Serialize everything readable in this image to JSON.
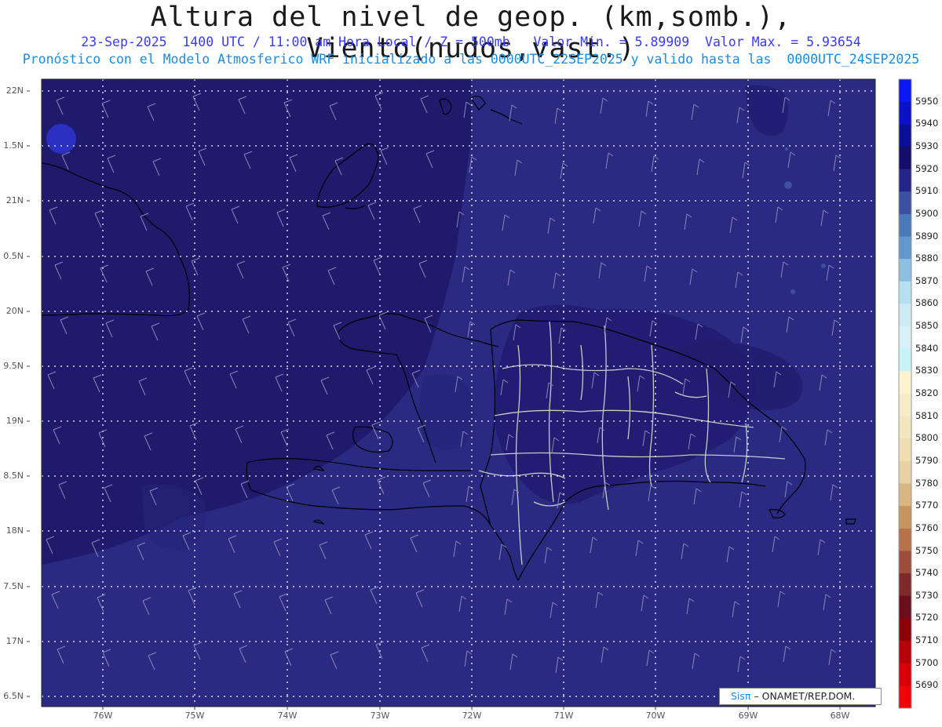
{
  "header": {
    "title": "Altura del nivel de geop. (km,somb.), Viento(nudos,vast.)",
    "subtitle": "23-Sep-2025  1400 UTC / 11:00 am Hora Local / Z = 500mb   Valor Min. = 5.89909  Valor Max. = 5.93654",
    "model_line": "Pronóstico con el Modelo Atmosferico WRF inicializado a las 0000UTC_22SEP2025 y valido hasta las  0000UTC_24SEP2025"
  },
  "map": {
    "lat_labels": [
      "22N",
      "1.5N",
      "21N",
      "0.5N",
      "20N",
      "9.5N",
      "19N",
      "8.5N",
      "18N",
      "7.5N",
      "17N",
      "6.5N"
    ],
    "lon_labels": [
      "76W",
      "75W",
      "74W",
      "73W",
      "72W",
      "71W",
      "70W",
      "69W",
      "68W"
    ],
    "colors": {
      "field_dark": "#1f1a6b",
      "field_mid": "#2a2a82",
      "field_blue": "#2b2fc2",
      "coast": "#000000",
      "provinces": "#c8c8c8",
      "grid": "#ffffff",
      "barbs": "#8a85b8"
    }
  },
  "colorbar": {
    "levels": [
      "5950",
      "5940",
      "5930",
      "5920",
      "5910",
      "5900",
      "5890",
      "5880",
      "5870",
      "5860",
      "5850",
      "5840",
      "5830",
      "5820",
      "5810",
      "5800",
      "5790",
      "5780",
      "5770",
      "5760",
      "5750",
      "5740",
      "5730",
      "5720",
      "5710",
      "5700",
      "5690"
    ],
    "colors": [
      "#0b17f5",
      "#0a12c8",
      "#0c0f96",
      "#150d6b",
      "#24248a",
      "#3b4fa3",
      "#4a79b9",
      "#5f98cc",
      "#8dc0e0",
      "#b4e0f0",
      "#cdebf4",
      "#d6f1f7",
      "#c8f2f8",
      "#fdf4cf",
      "#f6ecc8",
      "#f2e6c0",
      "#efdfb3",
      "#e8d2a5",
      "#d9b783",
      "#c79660",
      "#b6734b",
      "#9c4e3a",
      "#7f2a2a",
      "#6b0d1a",
      "#8c0008",
      "#b8000b",
      "#d80007",
      "#f10408"
    ]
  },
  "credit": {
    "brand": "Sisπ",
    "text": "– ONAMET/REP.DOM."
  }
}
